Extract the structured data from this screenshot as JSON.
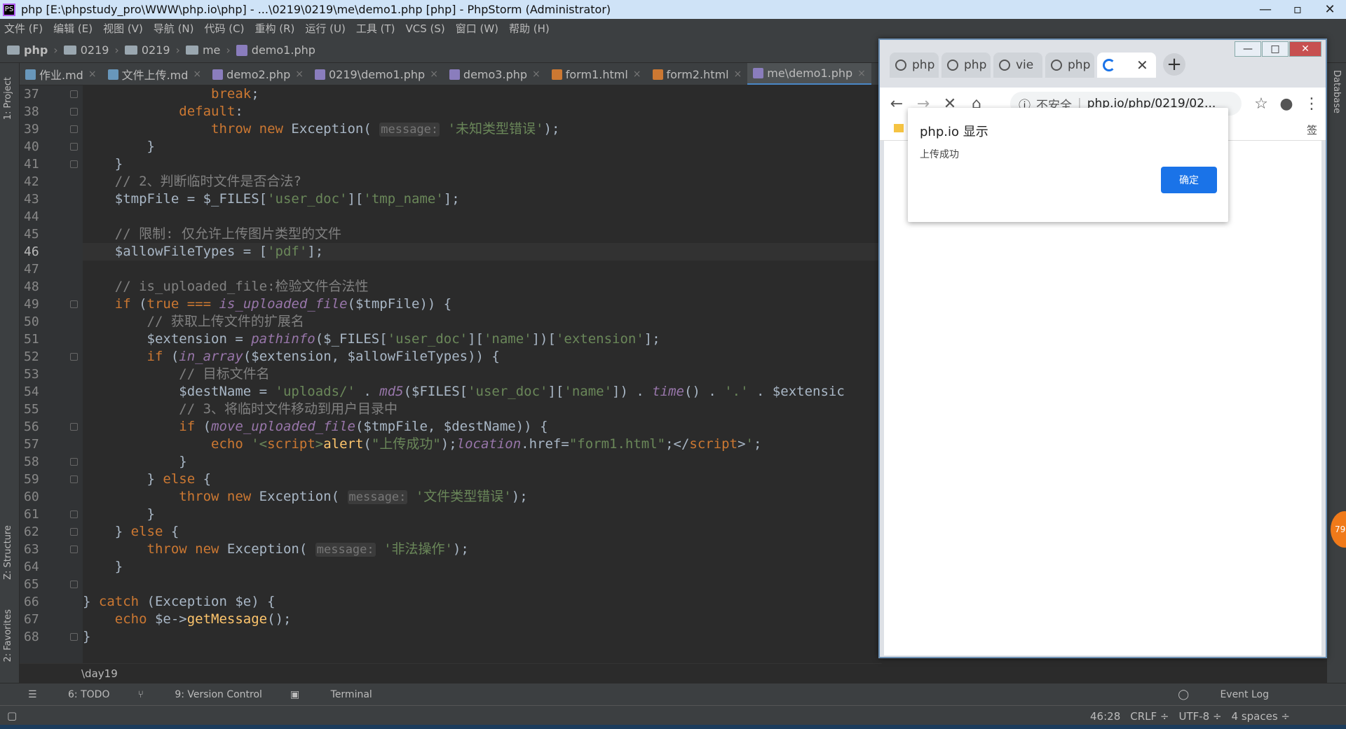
{
  "window": {
    "title": "php [E:\\phpstudy_pro\\WWW\\php.io\\php] - ...\\0219\\0219\\me\\demo1.php [php] - PhpStorm (Administrator)"
  },
  "menu": [
    "文件 (F)",
    "编辑 (E)",
    "视图 (V)",
    "导航 (N)",
    "代码 (C)",
    "重构 (R)",
    "运行 (U)",
    "工具 (T)",
    "VCS (S)",
    "窗口 (W)",
    "帮助 (H)"
  ],
  "breadcrumb": [
    "php",
    "0219",
    "0219",
    "me",
    "demo1.php"
  ],
  "tabs": [
    {
      "label": "作业.md",
      "type": "md"
    },
    {
      "label": "文件上传.md",
      "type": "md"
    },
    {
      "label": "demo2.php",
      "type": "php"
    },
    {
      "label": "0219\\demo1.php",
      "type": "php"
    },
    {
      "label": "demo3.php",
      "type": "php"
    },
    {
      "label": "form1.html",
      "type": "html"
    },
    {
      "label": "form2.html",
      "type": "html"
    },
    {
      "label": "me\\demo1.php",
      "type": "php"
    }
  ],
  "sidebar_left": {
    "project": "1: Project",
    "structure": "Z: Structure",
    "favorites": "2: Favorites"
  },
  "sidebar_right": {
    "database": "Database"
  },
  "code": {
    "highlight_line": "46",
    "lines": [
      {
        "n": "37"
      },
      {
        "n": "38"
      },
      {
        "n": "39"
      },
      {
        "n": "40"
      },
      {
        "n": "41"
      },
      {
        "n": "42"
      },
      {
        "n": "43"
      },
      {
        "n": "44"
      },
      {
        "n": "45"
      },
      {
        "n": "46"
      },
      {
        "n": "47"
      },
      {
        "n": "48"
      },
      {
        "n": "49"
      },
      {
        "n": "50"
      },
      {
        "n": "51"
      },
      {
        "n": "52"
      },
      {
        "n": "53"
      },
      {
        "n": "54"
      },
      {
        "n": "55"
      },
      {
        "n": "56"
      },
      {
        "n": "57"
      },
      {
        "n": "58"
      },
      {
        "n": "59"
      },
      {
        "n": "60"
      },
      {
        "n": "61"
      },
      {
        "n": "62"
      },
      {
        "n": "63"
      },
      {
        "n": "64"
      },
      {
        "n": "65"
      },
      {
        "n": "66"
      },
      {
        "n": "67"
      },
      {
        "n": "68"
      }
    ]
  },
  "editor_breadcrumb": "\\day19",
  "toolbar": {
    "todo": "6: TODO",
    "vcs": "9: Version Control",
    "terminal": "Terminal",
    "eventlog": "Event Log"
  },
  "status": {
    "position": "46:28",
    "line_sep": "CRLF ÷",
    "encoding": "UTF-8 ÷",
    "indent": "4 spaces ÷"
  },
  "browser": {
    "tabs": [
      "php",
      "php",
      "vie",
      "php"
    ],
    "insecure": "不安全",
    "url": "php.io/php/0219/02...",
    "bookmark_tail": "签",
    "dialog": {
      "title": "php.io 显示",
      "message": "上传成功",
      "ok": "确定"
    }
  },
  "notification_badge": "79",
  "colors": {
    "keyword": "#cc7832",
    "string": "#6a8759",
    "comment": "#808080",
    "accent": "#1a73e8"
  }
}
